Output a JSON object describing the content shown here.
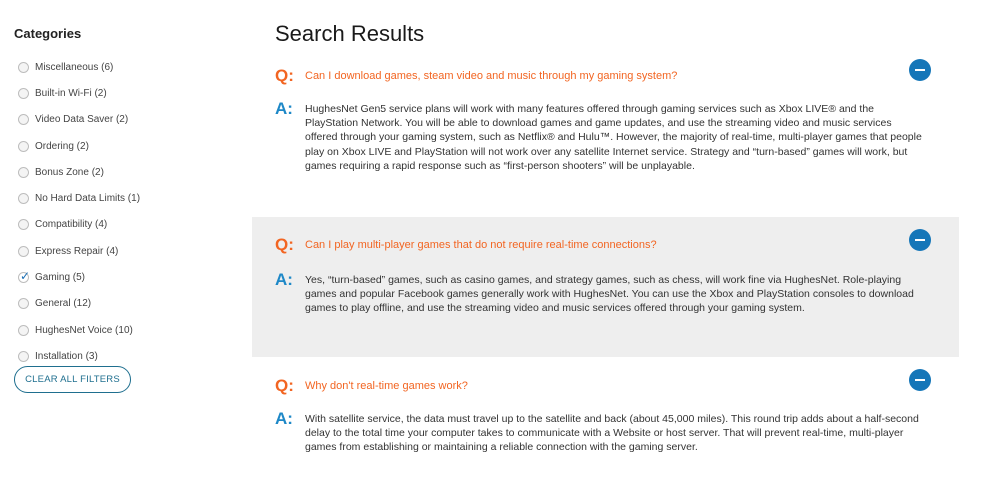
{
  "sidebar": {
    "title": "Categories",
    "categories": [
      {
        "label": "Miscellaneous (6)",
        "checked": false
      },
      {
        "label": "Built-in Wi-Fi (2)",
        "checked": false
      },
      {
        "label": "Video Data Saver (2)",
        "checked": false
      },
      {
        "label": "Ordering (2)",
        "checked": false
      },
      {
        "label": "Bonus Zone (2)",
        "checked": false
      },
      {
        "label": "No Hard Data Limits (1)",
        "checked": false
      },
      {
        "label": "Compatibility (4)",
        "checked": false
      },
      {
        "label": "Express Repair (4)",
        "checked": false
      },
      {
        "label": "Gaming (5)",
        "checked": true
      },
      {
        "label": "General (12)",
        "checked": false
      },
      {
        "label": "HughesNet Voice (10)",
        "checked": false
      },
      {
        "label": "Installation (3)",
        "checked": false
      }
    ],
    "clear_label": "CLEAR ALL FILTERS"
  },
  "main": {
    "title": "Search Results",
    "q_marker": "Q:",
    "a_marker": "A:",
    "faqs": [
      {
        "question": "Can I download games, steam video and music through my gaming system?",
        "answer": "HughesNet Gen5 service plans will work with many features offered through gaming services such as Xbox LIVE® and the PlayStation Network. You will be able to download games and game updates, and use the streaming video and music services offered through your gaming system, such as Netflix® and Hulu™. However, the majority of real-time, multi-player games that people play on Xbox LIVE and PlayStation will not work over any satellite Internet service. Strategy and “turn-based” games will work, but games requiring a rapid response such as “first-person shooters” will be unplayable."
      },
      {
        "question": "Can I play multi-player games that do not require real-time connections?",
        "answer": "Yes, “turn-based” games, such as casino games, and strategy games, such as chess, will work fine via HughesNet. Role-playing games and popular Facebook games generally work with HughesNet. You can use the Xbox and PlayStation consoles to download games to play offline, and use the streaming video and music services offered through your gaming system."
      },
      {
        "question": "Why don't real-time games work?",
        "answer": "With satellite service, the data must travel up to the satellite and back (about 45,000 miles). This round trip adds about a half-second delay to the total time your computer takes to communicate with a Website or host server. That will prevent real-time, multi-player games from establishing or maintaining a reliable connection with the gaming server."
      }
    ]
  },
  "colors": {
    "question": "#f26522",
    "answer_marker": "#1e88c7",
    "collapse_button": "#1576b8",
    "shaded_row": "#eeeeee"
  },
  "icons": {
    "collapse": "minus-circle-icon",
    "checked": "checkmark-icon"
  }
}
